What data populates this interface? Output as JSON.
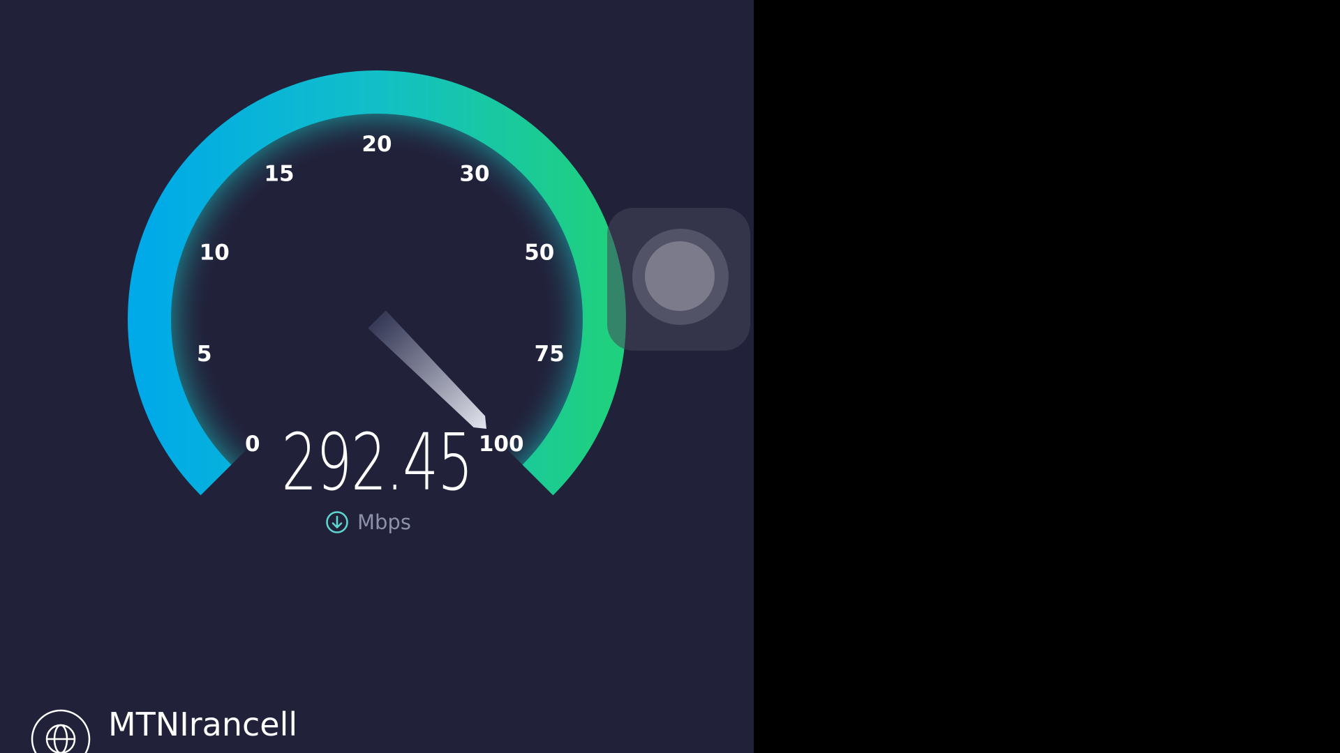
{
  "speedometer": {
    "ticks": [
      "0",
      "5",
      "10",
      "15",
      "20",
      "30",
      "50",
      "75",
      "100"
    ],
    "reading": 292.45,
    "reading_text": "292.45",
    "unit": "Mbps",
    "unit_icon": "download-arrow-icon"
  },
  "provider": {
    "name": "MTNIrancell",
    "icon": "globe-icon"
  },
  "assistive_touch": {
    "icon": "assistive-touch-icon"
  },
  "colors": {
    "background": "#21213a",
    "gauge_start": "#00aae8",
    "gauge_end": "#1fd07f",
    "letterbox": "#000000"
  }
}
